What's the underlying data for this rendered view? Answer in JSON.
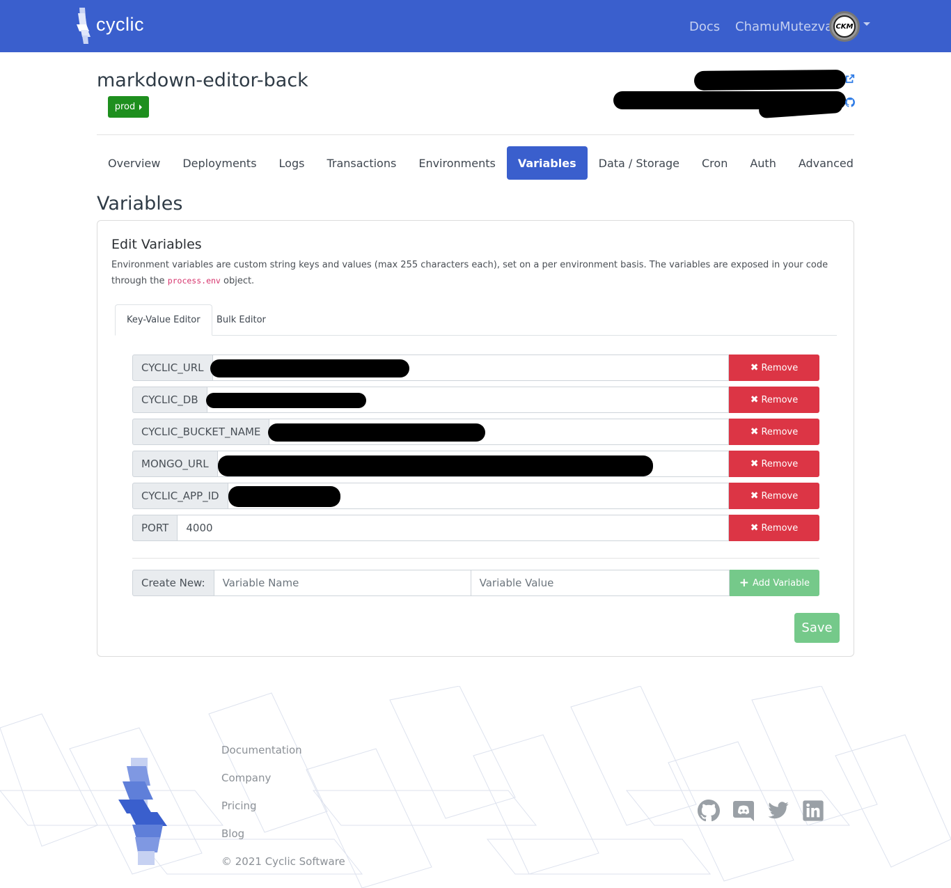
{
  "navbar": {
    "brand": "cyclic",
    "docs_label": "Docs",
    "username": "ChamuMutezva",
    "avatar_initials": "CKM",
    "colors": {
      "background": "#3a5fcd"
    }
  },
  "app": {
    "title": "markdown-editor-back",
    "env_button_label": "prod"
  },
  "tabs": [
    {
      "label": "Overview",
      "active": false
    },
    {
      "label": "Deployments",
      "active": false
    },
    {
      "label": "Logs",
      "active": false
    },
    {
      "label": "Transactions",
      "active": false
    },
    {
      "label": "Environments",
      "active": false
    },
    {
      "label": "Variables",
      "active": true
    },
    {
      "label": "Data / Storage",
      "active": false
    },
    {
      "label": "Cron",
      "active": false
    },
    {
      "label": "Auth",
      "active": false
    },
    {
      "label": "Advanced",
      "active": false
    }
  ],
  "section_title": "Variables",
  "card": {
    "title": "Edit Variables",
    "desc_before": "Environment variables are custom string keys and values (max 255 characters each), set on a per environment basis. The variables are exposed in your code through the",
    "desc_code": "process.env",
    "desc_after": "object.",
    "subtabs": [
      {
        "label": "Key-Value Editor",
        "active": true
      },
      {
        "label": "Bulk Editor",
        "active": false
      }
    ],
    "variables": [
      {
        "key": "CYCLIC_URL",
        "value": "",
        "redacted": true
      },
      {
        "key": "CYCLIC_DB",
        "value": "",
        "redacted": true
      },
      {
        "key": "CYCLIC_BUCKET_NAME",
        "value": "",
        "redacted": true
      },
      {
        "key": "MONGO_URL",
        "value": "",
        "redacted": true
      },
      {
        "key": "CYCLIC_APP_ID",
        "value": "",
        "redacted": true
      },
      {
        "key": "PORT",
        "value": "4000",
        "redacted": false
      }
    ],
    "remove_label": "Remove",
    "create_new_label": "Create New:",
    "name_placeholder": "Variable Name",
    "value_placeholder": "Variable Value",
    "add_label": "Add Variable",
    "save_label": "Save",
    "colors": {
      "danger": "#dc3545",
      "success": "#75c98a"
    }
  },
  "footer": {
    "links": [
      "Documentation",
      "Company",
      "Pricing",
      "Blog"
    ],
    "copyright": "© 2021 Cyclic Software",
    "social_icons": [
      "github-icon",
      "discord-icon",
      "twitter-icon",
      "linkedin-icon"
    ]
  }
}
